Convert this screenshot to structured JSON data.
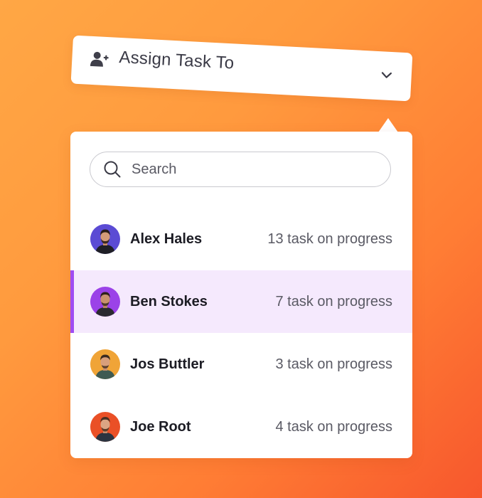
{
  "assign": {
    "label": "Assign Task To",
    "icon": "user-plus-icon",
    "dropdown_icon": "chevron-down-icon"
  },
  "search": {
    "placeholder": "Search",
    "value": ""
  },
  "users": [
    {
      "name": "Alex Hales",
      "status": "13 task on progress",
      "avatar_color": "#5b4bd4",
      "selected": false
    },
    {
      "name": "Ben Stokes",
      "status": "7 task on progress",
      "avatar_color": "#9b42e8",
      "selected": true
    },
    {
      "name": "Jos Buttler",
      "status": "3 task on progress",
      "avatar_color": "#f0a437",
      "selected": false
    },
    {
      "name": "Joe Root",
      "status": "4 task on progress",
      "avatar_color": "#ea5026",
      "selected": false
    }
  ],
  "colors": {
    "selected_background": "#f5e9fd",
    "selected_accent": "#a04cf2",
    "text_primary": "#1c1c24",
    "text_secondary": "#5a5a64"
  }
}
